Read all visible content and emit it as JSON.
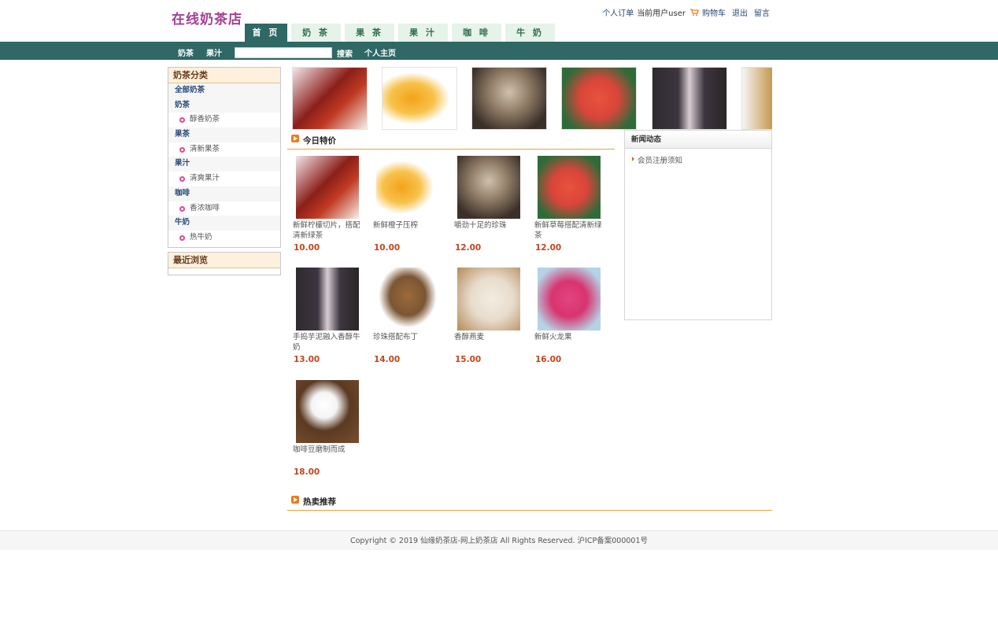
{
  "header": {
    "logo": "在线奶茶店",
    "links": {
      "orders": "个人订单",
      "current_user": "当前用户user",
      "cart": "购物车",
      "logout": "退出",
      "message": "留言"
    },
    "tabs": [
      "首 页",
      "奶 茶",
      "果 茶",
      "果 汁",
      "咖 啡",
      "牛 奶"
    ]
  },
  "navbar": {
    "item1": "奶茶",
    "item2": "果汁",
    "search_value": "",
    "search_btn": "搜索",
    "home": "个人主页"
  },
  "sidebar": {
    "category_title": "奶茶分类",
    "all": "全部奶茶",
    "groups": [
      {
        "name": "奶茶",
        "sub": "醇香奶茶"
      },
      {
        "name": "果茶",
        "sub": "清新果茶"
      },
      {
        "name": "果汁",
        "sub": "清爽果汁"
      },
      {
        "name": "咖啡",
        "sub": "香浓咖啡"
      },
      {
        "name": "牛奶",
        "sub": "热牛奶"
      }
    ],
    "recent_title": "最近浏览"
  },
  "sections": {
    "today": "今日特价",
    "hot": "热卖推荐"
  },
  "products": [
    {
      "name": "新鲜柠檬切片，搭配清新绿茶",
      "price": "10.00",
      "color": "#8a1f1a"
    },
    {
      "name": "新鲜橙子压榨",
      "price": "10.00",
      "color": "#f4a21a"
    },
    {
      "name": "嚼劲十足的珍珠",
      "price": "12.00",
      "color": "#8d7a64"
    },
    {
      "name": "新鲜草莓搭配清新绿茶",
      "price": "12.00",
      "color": "#d9453a"
    },
    {
      "name": "手捣芋泥融入香醇牛奶",
      "price": "13.00",
      "color": "#cfc4c8"
    },
    {
      "name": "珍珠搭配布丁",
      "price": "14.00",
      "color": "#9c6a3a"
    },
    {
      "name": "香醇燕麦",
      "price": "15.00",
      "color": "#e8dccc"
    },
    {
      "name": "新鲜火龙果",
      "price": "16.00",
      "color": "#d8346f"
    },
    {
      "name": "咖啡豆磨制而成",
      "price": "18.00",
      "color": "#5a3a22"
    }
  ],
  "news": {
    "title": "新闻动态",
    "items": [
      "会员注册须知"
    ]
  },
  "footer": "Copyright © 2019 仙缘奶茶店-网上奶茶店 All Rights Reserved. 沪ICP备案000001号"
}
